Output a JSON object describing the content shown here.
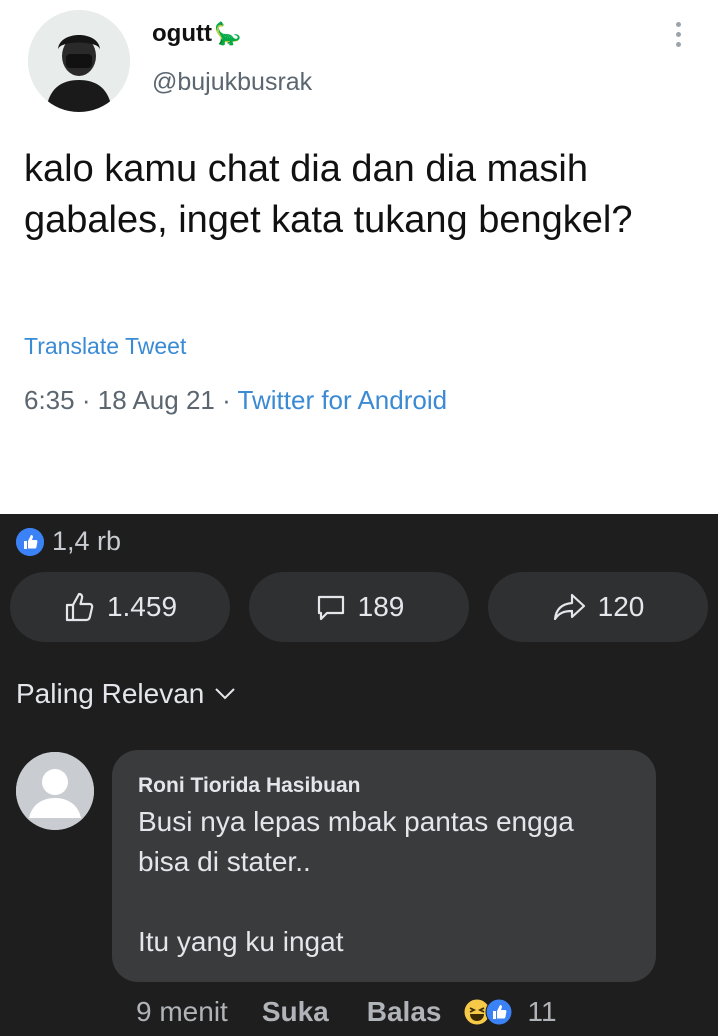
{
  "tweet": {
    "display_name": "ogutt",
    "display_emoji": "🦕",
    "handle": "@bujukbusrak",
    "text": "kalo kamu chat dia dan dia masih gabales, inget kata tukang bengkel?",
    "translate_label": "Translate Tweet",
    "time": "6:35",
    "date": "18 Aug 21",
    "source": "Twitter for Android",
    "separator": "·"
  },
  "facebook": {
    "reaction_count": "1,4 rb",
    "actions": {
      "like_count": "1.459",
      "comment_count": "189",
      "share_count": "120"
    },
    "sort_label": "Paling Relevan",
    "comment": {
      "author": "Roni Tiorida Hasibuan",
      "lines": [
        "Busi nya lepas mbak pantas engga",
        "bisa di stater..",
        "Itu yang ku ingat"
      ],
      "time": "9 menit",
      "like_label": "Suka",
      "reply_label": "Balas",
      "reaction_count": "11"
    }
  },
  "colors": {
    "link_blue": "#3a8ad4",
    "fb_dark_bg": "#1e1e1e",
    "fb_pill": "#2f3031",
    "fb_bubble": "#3a3b3c",
    "like_blue": "#3b82f6",
    "haha_yellow": "#f7c948"
  },
  "icons": [
    "kebab-menu-icon",
    "thumbs-up-icon",
    "comment-icon",
    "share-arrow-icon",
    "chevron-down-icon",
    "like-reaction-icon",
    "haha-reaction-icon"
  ]
}
